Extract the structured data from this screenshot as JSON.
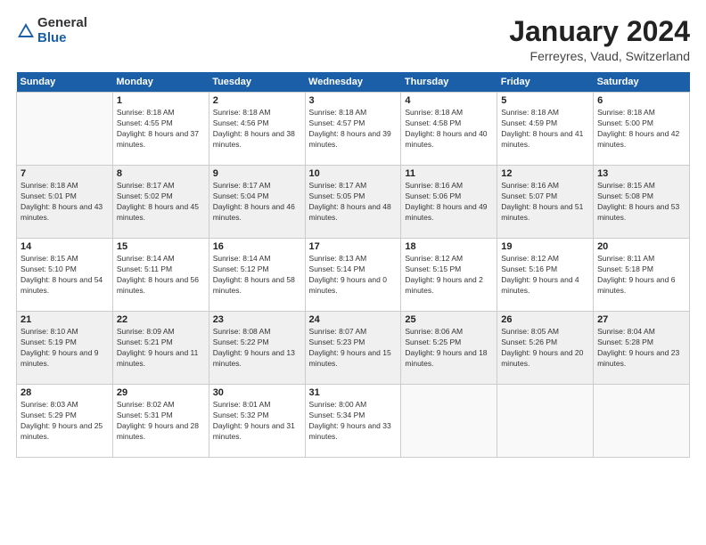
{
  "header": {
    "logo_general": "General",
    "logo_blue": "Blue",
    "month_title": "January 2024",
    "location": "Ferreyres, Vaud, Switzerland"
  },
  "days_of_week": [
    "Sunday",
    "Monday",
    "Tuesday",
    "Wednesday",
    "Thursday",
    "Friday",
    "Saturday"
  ],
  "weeks": [
    [
      {
        "day": "",
        "sunrise": "",
        "sunset": "",
        "daylight": ""
      },
      {
        "day": "1",
        "sunrise": "Sunrise: 8:18 AM",
        "sunset": "Sunset: 4:55 PM",
        "daylight": "Daylight: 8 hours and 37 minutes."
      },
      {
        "day": "2",
        "sunrise": "Sunrise: 8:18 AM",
        "sunset": "Sunset: 4:56 PM",
        "daylight": "Daylight: 8 hours and 38 minutes."
      },
      {
        "day": "3",
        "sunrise": "Sunrise: 8:18 AM",
        "sunset": "Sunset: 4:57 PM",
        "daylight": "Daylight: 8 hours and 39 minutes."
      },
      {
        "day": "4",
        "sunrise": "Sunrise: 8:18 AM",
        "sunset": "Sunset: 4:58 PM",
        "daylight": "Daylight: 8 hours and 40 minutes."
      },
      {
        "day": "5",
        "sunrise": "Sunrise: 8:18 AM",
        "sunset": "Sunset: 4:59 PM",
        "daylight": "Daylight: 8 hours and 41 minutes."
      },
      {
        "day": "6",
        "sunrise": "Sunrise: 8:18 AM",
        "sunset": "Sunset: 5:00 PM",
        "daylight": "Daylight: 8 hours and 42 minutes."
      }
    ],
    [
      {
        "day": "7",
        "sunrise": "Sunrise: 8:18 AM",
        "sunset": "Sunset: 5:01 PM",
        "daylight": "Daylight: 8 hours and 43 minutes."
      },
      {
        "day": "8",
        "sunrise": "Sunrise: 8:17 AM",
        "sunset": "Sunset: 5:02 PM",
        "daylight": "Daylight: 8 hours and 45 minutes."
      },
      {
        "day": "9",
        "sunrise": "Sunrise: 8:17 AM",
        "sunset": "Sunset: 5:04 PM",
        "daylight": "Daylight: 8 hours and 46 minutes."
      },
      {
        "day": "10",
        "sunrise": "Sunrise: 8:17 AM",
        "sunset": "Sunset: 5:05 PM",
        "daylight": "Daylight: 8 hours and 48 minutes."
      },
      {
        "day": "11",
        "sunrise": "Sunrise: 8:16 AM",
        "sunset": "Sunset: 5:06 PM",
        "daylight": "Daylight: 8 hours and 49 minutes."
      },
      {
        "day": "12",
        "sunrise": "Sunrise: 8:16 AM",
        "sunset": "Sunset: 5:07 PM",
        "daylight": "Daylight: 8 hours and 51 minutes."
      },
      {
        "day": "13",
        "sunrise": "Sunrise: 8:15 AM",
        "sunset": "Sunset: 5:08 PM",
        "daylight": "Daylight: 8 hours and 53 minutes."
      }
    ],
    [
      {
        "day": "14",
        "sunrise": "Sunrise: 8:15 AM",
        "sunset": "Sunset: 5:10 PM",
        "daylight": "Daylight: 8 hours and 54 minutes."
      },
      {
        "day": "15",
        "sunrise": "Sunrise: 8:14 AM",
        "sunset": "Sunset: 5:11 PM",
        "daylight": "Daylight: 8 hours and 56 minutes."
      },
      {
        "day": "16",
        "sunrise": "Sunrise: 8:14 AM",
        "sunset": "Sunset: 5:12 PM",
        "daylight": "Daylight: 8 hours and 58 minutes."
      },
      {
        "day": "17",
        "sunrise": "Sunrise: 8:13 AM",
        "sunset": "Sunset: 5:14 PM",
        "daylight": "Daylight: 9 hours and 0 minutes."
      },
      {
        "day": "18",
        "sunrise": "Sunrise: 8:12 AM",
        "sunset": "Sunset: 5:15 PM",
        "daylight": "Daylight: 9 hours and 2 minutes."
      },
      {
        "day": "19",
        "sunrise": "Sunrise: 8:12 AM",
        "sunset": "Sunset: 5:16 PM",
        "daylight": "Daylight: 9 hours and 4 minutes."
      },
      {
        "day": "20",
        "sunrise": "Sunrise: 8:11 AM",
        "sunset": "Sunset: 5:18 PM",
        "daylight": "Daylight: 9 hours and 6 minutes."
      }
    ],
    [
      {
        "day": "21",
        "sunrise": "Sunrise: 8:10 AM",
        "sunset": "Sunset: 5:19 PM",
        "daylight": "Daylight: 9 hours and 9 minutes."
      },
      {
        "day": "22",
        "sunrise": "Sunrise: 8:09 AM",
        "sunset": "Sunset: 5:21 PM",
        "daylight": "Daylight: 9 hours and 11 minutes."
      },
      {
        "day": "23",
        "sunrise": "Sunrise: 8:08 AM",
        "sunset": "Sunset: 5:22 PM",
        "daylight": "Daylight: 9 hours and 13 minutes."
      },
      {
        "day": "24",
        "sunrise": "Sunrise: 8:07 AM",
        "sunset": "Sunset: 5:23 PM",
        "daylight": "Daylight: 9 hours and 15 minutes."
      },
      {
        "day": "25",
        "sunrise": "Sunrise: 8:06 AM",
        "sunset": "Sunset: 5:25 PM",
        "daylight": "Daylight: 9 hours and 18 minutes."
      },
      {
        "day": "26",
        "sunrise": "Sunrise: 8:05 AM",
        "sunset": "Sunset: 5:26 PM",
        "daylight": "Daylight: 9 hours and 20 minutes."
      },
      {
        "day": "27",
        "sunrise": "Sunrise: 8:04 AM",
        "sunset": "Sunset: 5:28 PM",
        "daylight": "Daylight: 9 hours and 23 minutes."
      }
    ],
    [
      {
        "day": "28",
        "sunrise": "Sunrise: 8:03 AM",
        "sunset": "Sunset: 5:29 PM",
        "daylight": "Daylight: 9 hours and 25 minutes."
      },
      {
        "day": "29",
        "sunrise": "Sunrise: 8:02 AM",
        "sunset": "Sunset: 5:31 PM",
        "daylight": "Daylight: 9 hours and 28 minutes."
      },
      {
        "day": "30",
        "sunrise": "Sunrise: 8:01 AM",
        "sunset": "Sunset: 5:32 PM",
        "daylight": "Daylight: 9 hours and 31 minutes."
      },
      {
        "day": "31",
        "sunrise": "Sunrise: 8:00 AM",
        "sunset": "Sunset: 5:34 PM",
        "daylight": "Daylight: 9 hours and 33 minutes."
      },
      {
        "day": "",
        "sunrise": "",
        "sunset": "",
        "daylight": ""
      },
      {
        "day": "",
        "sunrise": "",
        "sunset": "",
        "daylight": ""
      },
      {
        "day": "",
        "sunrise": "",
        "sunset": "",
        "daylight": ""
      }
    ]
  ]
}
